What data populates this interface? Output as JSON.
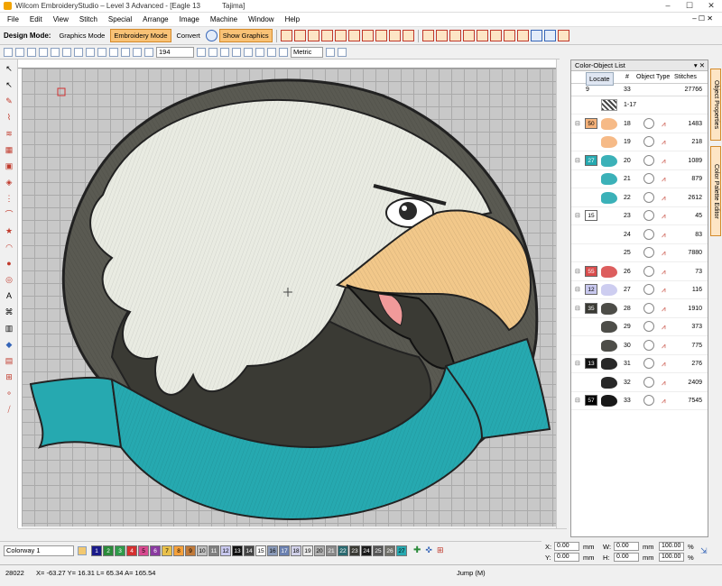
{
  "app": {
    "title": "Wilcom EmbroideryStudio – Level 3 Advanced - [Eagle 13",
    "machine": "Tajima]"
  },
  "window": {
    "minimize": "–",
    "maximize": "☐",
    "close": "✕"
  },
  "menu": [
    "File",
    "Edit",
    "View",
    "Stitch",
    "Special",
    "Arrange",
    "Image",
    "Machine",
    "Window",
    "Help"
  ],
  "toolbar": {
    "design_mode_label": "Design Mode:",
    "graphics_mode": "Graphics Mode",
    "embroidery_mode": "Embroidery Mode",
    "convert": "Convert",
    "show_graphics": "Show Graphics",
    "zoom": "194",
    "units": "Metric"
  },
  "panel": {
    "title": "Color-Object List",
    "locate": "Locate",
    "col_num": "#",
    "col_type": "Object Type",
    "col_stitches": "Stitches",
    "top_left": "9",
    "top_num": "33",
    "top_stitches": "27766"
  },
  "rows": [
    {
      "chip": "",
      "chip_color": "#ffffff",
      "num": "1-17",
      "st": "",
      "shape": "hatch"
    },
    {
      "chip": "50",
      "chip_color": "#f5b27a",
      "num": "18",
      "st": "1483",
      "shape": "#f5b27a"
    },
    {
      "chip": "",
      "chip_color": "",
      "num": "19",
      "st": "218",
      "shape": "#f5b27a"
    },
    {
      "chip": "27",
      "chip_color": "#26a9b0",
      "num": "20",
      "st": "1089",
      "shape": "#26a9b0"
    },
    {
      "chip": "",
      "chip_color": "",
      "num": "21",
      "st": "879",
      "shape": "#26a9b0"
    },
    {
      "chip": "",
      "chip_color": "",
      "num": "22",
      "st": "2612",
      "shape": "#26a9b0"
    },
    {
      "chip": "15",
      "chip_color": "#ffffff",
      "num": "23",
      "st": "45",
      "shape": "#ffffff"
    },
    {
      "chip": "",
      "chip_color": "",
      "num": "24",
      "st": "83",
      "shape": "#ffffff"
    },
    {
      "chip": "",
      "chip_color": "",
      "num": "25",
      "st": "7880",
      "shape": "#ffffff"
    },
    {
      "chip": "55",
      "chip_color": "#d94c4c",
      "num": "26",
      "st": "73",
      "shape": "#d94c4c"
    },
    {
      "chip": "12",
      "chip_color": "#c8c8ee",
      "num": "27",
      "st": "116",
      "shape": "#c8c8ee"
    },
    {
      "chip": "35",
      "chip_color": "#3a3a34",
      "num": "28",
      "st": "1910",
      "shape": "#3a3a34"
    },
    {
      "chip": "",
      "chip_color": "",
      "num": "29",
      "st": "373",
      "shape": "#3a3a34"
    },
    {
      "chip": "",
      "chip_color": "",
      "num": "30",
      "st": "775",
      "shape": "#3a3a34"
    },
    {
      "chip": "13",
      "chip_color": "#111111",
      "num": "31",
      "st": "276",
      "shape": "#111111"
    },
    {
      "chip": "",
      "chip_color": "",
      "num": "32",
      "st": "2409",
      "shape": "#111111"
    },
    {
      "chip": "57",
      "chip_color": "#000000",
      "num": "33",
      "st": "7545",
      "shape": "#000000"
    }
  ],
  "sidetabs": [
    "Object Properties",
    "Color Palette Editor"
  ],
  "colorway": "Colorway 1",
  "swatches": [
    {
      "n": "1",
      "c": "#1a1a8a"
    },
    {
      "n": "2",
      "c": "#2b8a3a"
    },
    {
      "n": "3",
      "c": "#2f9a4a"
    },
    {
      "n": "4",
      "c": "#d43030"
    },
    {
      "n": "5",
      "c": "#d84a90"
    },
    {
      "n": "6",
      "c": "#8a3aa0"
    },
    {
      "n": "7",
      "c": "#e8c04a"
    },
    {
      "n": "8",
      "c": "#f5a03a"
    },
    {
      "n": "9",
      "c": "#c07a3a"
    },
    {
      "n": "10",
      "c": "#c0c0c0"
    },
    {
      "n": "11",
      "c": "#808080"
    },
    {
      "n": "12",
      "c": "#c8c8ee"
    },
    {
      "n": "13",
      "c": "#111111"
    },
    {
      "n": "14",
      "c": "#444444"
    },
    {
      "n": "15",
      "c": "#ffffff"
    },
    {
      "n": "16",
      "c": "#8a9ab8"
    },
    {
      "n": "17",
      "c": "#6a80b0"
    },
    {
      "n": "18",
      "c": "#d0d0e8"
    },
    {
      "n": "19",
      "c": "#e8e8e8"
    },
    {
      "n": "20",
      "c": "#b0b0b0"
    },
    {
      "n": "21",
      "c": "#8a8a8a"
    },
    {
      "n": "22",
      "c": "#2a6a70"
    },
    {
      "n": "23",
      "c": "#3a3a34"
    },
    {
      "n": "24",
      "c": "#1a1a1a"
    },
    {
      "n": "25",
      "c": "#555"
    },
    {
      "n": "26",
      "c": "#70706a"
    },
    {
      "n": "27",
      "c": "#26a9b0"
    }
  ],
  "coords": {
    "x_label": "X:",
    "x": "0.00",
    "y_label": "Y:",
    "y": "0.00",
    "w_label": "W:",
    "w": "0.00",
    "h_label": "H:",
    "h": "0.00",
    "unit": "mm",
    "sx": "100.00",
    "sy": "100.00",
    "pct": "%"
  },
  "status": {
    "stitches": "28022",
    "position": "X= -63.27 Y= 16.31 L= 65.34 A= 165.54",
    "mode": "Jump (M)"
  }
}
